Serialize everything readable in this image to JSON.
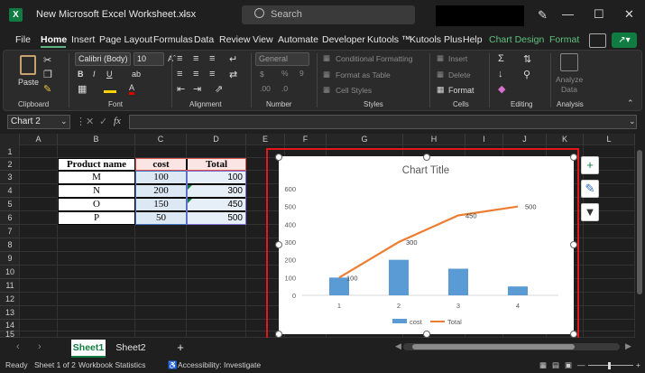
{
  "titlebar": {
    "app_icon_letter": "X",
    "document_title": "New Microsoft Excel Worksheet.xlsx",
    "search_placeholder": "Search",
    "window_buttons": [
      "—",
      "☐",
      "✕"
    ]
  },
  "ribbon_tabs": [
    "File",
    "Home",
    "Insert",
    "Page Layout",
    "Formulas",
    "Data",
    "Review",
    "View",
    "Automate",
    "Developer",
    "Kutools ™",
    "Kutools Plus",
    "Help",
    "Chart Design",
    "Format"
  ],
  "ribbon": {
    "clipboard": {
      "paste_label": "Paste",
      "group_label": "Clipboard"
    },
    "font": {
      "font_name": "Calibri (Body)",
      "font_size": "10",
      "group_label": "Font"
    },
    "alignment": {
      "group_label": "Alignment"
    },
    "number": {
      "format_value": "General",
      "group_label": "Number"
    },
    "styles": {
      "conditional_formatting": "Conditional Formatting",
      "format_as_table": "Format as Table",
      "cell_styles": "Cell Styles",
      "group_label": "Styles"
    },
    "cells": {
      "insert": "Insert",
      "delete": "Delete",
      "format": "Format",
      "group_label": "Cells"
    },
    "editing": {
      "group_label": "Editing"
    },
    "analysis": {
      "analyze_label_1": "Analyze",
      "analyze_label_2": "Data",
      "group_label": "Analysis"
    }
  },
  "formula_bar": {
    "name_box": "Chart 2",
    "fx_label": "fx",
    "formula_value": ""
  },
  "columns": [
    "A",
    "B",
    "C",
    "D",
    "E",
    "F",
    "G",
    "H",
    "I",
    "J",
    "K",
    "L"
  ],
  "rows": [
    "1",
    "2",
    "3",
    "4",
    "5",
    "6",
    "7",
    "8",
    "9",
    "10",
    "11",
    "12",
    "13",
    "14",
    "15"
  ],
  "table": {
    "headers": [
      "Product name",
      "cost",
      "Total"
    ],
    "rows": [
      [
        "M",
        "100",
        "100"
      ],
      [
        "N",
        "200",
        "300"
      ],
      [
        "O",
        "150",
        "450"
      ],
      [
        "P",
        "50",
        "500"
      ]
    ]
  },
  "chart_data": {
    "type": "bar",
    "title": "Chart Title",
    "categories": [
      "1",
      "2",
      "3",
      "4"
    ],
    "ylim": [
      0,
      600
    ],
    "yticks": [
      "0",
      "100",
      "200",
      "300",
      "400",
      "500",
      "600"
    ],
    "series": [
      {
        "name": "cost",
        "type": "bar",
        "color": "#5b9bd5",
        "values": [
          100,
          200,
          150,
          50
        ]
      },
      {
        "name": "Total",
        "type": "line",
        "color": "#ed7d31",
        "values": [
          100,
          300,
          450,
          500
        ],
        "data_labels": [
          "100",
          "300",
          "450",
          "500"
        ]
      }
    ],
    "legend_position": "bottom",
    "grid": false
  },
  "sheets": {
    "tabs": [
      "Sheet1",
      "Sheet2"
    ],
    "active": "Sheet1",
    "add_label": "+"
  },
  "statusbar": {
    "ready": "Ready",
    "sheet_count": "Sheet 1 of 2",
    "workbook_statistics": "Workbook Statistics",
    "accessibility": "Accessibility: Investigate"
  },
  "colors": {
    "accent": "#107c41",
    "selection_border": "#e0171b"
  }
}
